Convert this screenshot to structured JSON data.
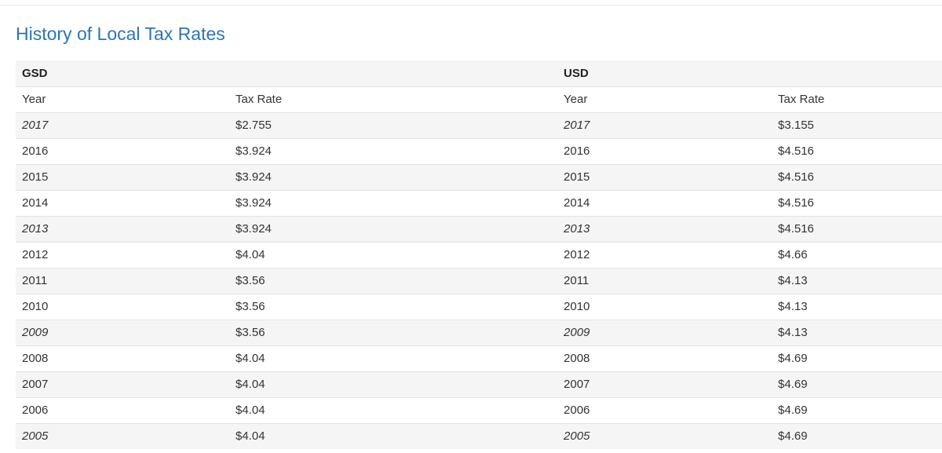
{
  "title": "History of Local Tax Rates",
  "groups": {
    "left": "GSD",
    "right": "USD"
  },
  "column_headers": {
    "left_year": "Year",
    "left_rate": "Tax Rate",
    "right_year": "Year",
    "right_rate": "Tax Rate"
  },
  "rows": [
    {
      "gsd_year": "2017",
      "gsd_rate": "$2.755",
      "usd_year": "2017",
      "usd_rate": "$3.155"
    },
    {
      "gsd_year": "2016",
      "gsd_rate": "$3.924",
      "usd_year": "2016",
      "usd_rate": "$4.516"
    },
    {
      "gsd_year": "2015",
      "gsd_rate": "$3.924",
      "usd_year": "2015",
      "usd_rate": "$4.516"
    },
    {
      "gsd_year": "2014",
      "gsd_rate": "$3.924",
      "usd_year": "2014",
      "usd_rate": "$4.516"
    },
    {
      "gsd_year": "2013",
      "gsd_rate": "$3.924",
      "usd_year": "2013",
      "usd_rate": "$4.516"
    },
    {
      "gsd_year": "2012",
      "gsd_rate": "$4.04",
      "usd_year": "2012",
      "usd_rate": "$4.66"
    },
    {
      "gsd_year": "2011",
      "gsd_rate": "$3.56",
      "usd_year": "2011",
      "usd_rate": "$4.13"
    },
    {
      "gsd_year": "2010",
      "gsd_rate": "$3.56",
      "usd_year": "2010",
      "usd_rate": "$4.13"
    },
    {
      "gsd_year": "2009",
      "gsd_rate": "$3.56",
      "usd_year": "2009",
      "usd_rate": "$4.13"
    },
    {
      "gsd_year": "2008",
      "gsd_rate": "$4.04",
      "usd_year": "2008",
      "usd_rate": "$4.69"
    },
    {
      "gsd_year": "2007",
      "gsd_rate": "$4.04",
      "usd_year": "2007",
      "usd_rate": "$4.69"
    },
    {
      "gsd_year": "2006",
      "gsd_rate": "$4.04",
      "usd_year": "2006",
      "usd_rate": "$4.69"
    },
    {
      "gsd_year": "2005",
      "gsd_rate": "$4.04",
      "usd_year": "2005",
      "usd_rate": "$4.69"
    }
  ]
}
